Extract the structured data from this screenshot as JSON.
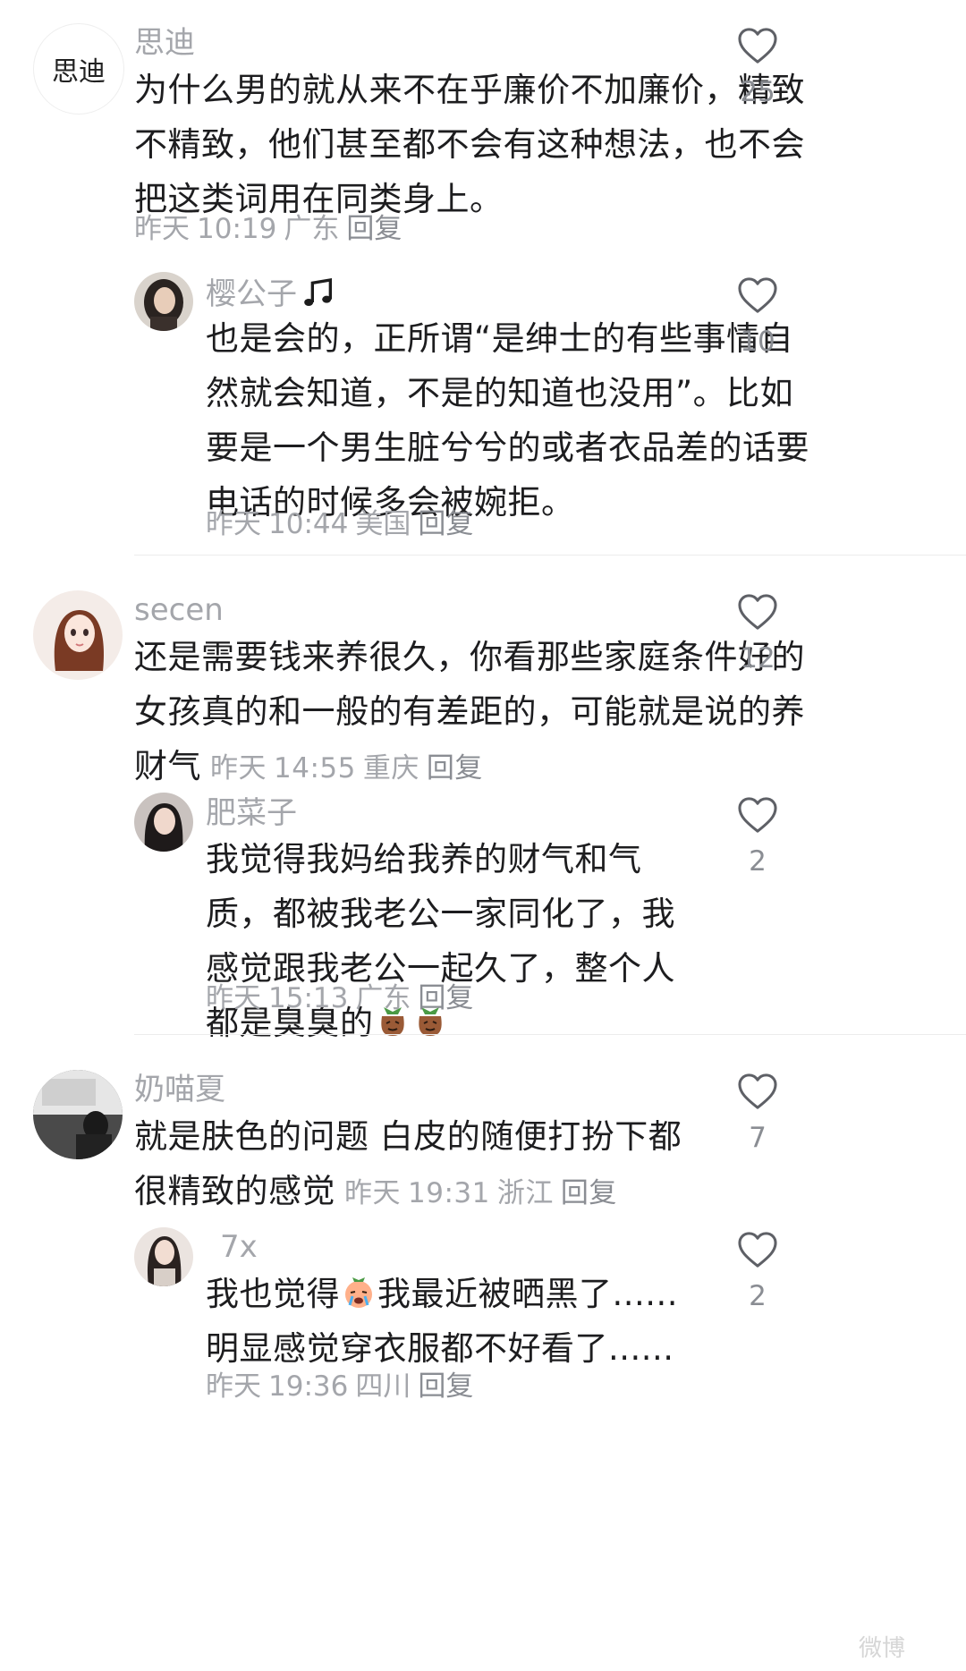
{
  "comments": [
    {
      "id": "c1",
      "username": "思迪",
      "avatar_text": "思迪",
      "text": "为什么男的就从来不在乎廉价不加廉价，精致不精致，他们甚至都不会有这种想法，也不会把这类词用在同类身上。",
      "date": "昨天",
      "time": "10:19",
      "location": "广东",
      "reply_label": "回复",
      "likes": "25",
      "reply": {
        "username": "樱公子",
        "username_icon": "music-note-icon",
        "text": "也是会的，正所谓“是绅士的有些事情自然就会知道，不是的知道也没用”。比如要是一个男生脏兮兮的或者衣品差的话要电话的时候多会被婉拒。",
        "date": "昨天",
        "time": "10:44",
        "location": "美国",
        "reply_label": "回复",
        "likes": "10"
      }
    },
    {
      "id": "c2",
      "username": "secen",
      "text": "还是需要钱来养很久，你看那些家庭条件好的女孩真的和一般的有差距的，可能就是说的养财气",
      "date": "昨天",
      "time": "14:55",
      "location": "重庆",
      "reply_label": "回复",
      "likes": "12",
      "reply": {
        "username": "肥菜子",
        "text": "我觉得我妈给我养的财气和气质，都被我老公一家同化了，我感觉跟我老公一起久了，整个人都是臭臭的",
        "emoji": "poop-bag-emoji",
        "date": "昨天",
        "time": "15:13",
        "location": "广东",
        "reply_label": "回复",
        "likes": "2"
      }
    },
    {
      "id": "c3",
      "username": "奶喵夏",
      "text": "就是肤色的问题 白皮的随便打扮下都很精致的感觉",
      "date": "昨天",
      "time": "19:31",
      "location": "浙江",
      "reply_label": "回复",
      "likes": "7",
      "reply": {
        "username": "7x",
        "text_a": "我也觉得",
        "emoji": "crying-face-emoji",
        "text_b": "我最近被晒黑了......明显感觉穿衣服都不好看了......",
        "date": "昨天",
        "time": "19:36",
        "location": "四川",
        "reply_label": "回复",
        "likes": "2"
      }
    }
  ],
  "watermark": "微博"
}
